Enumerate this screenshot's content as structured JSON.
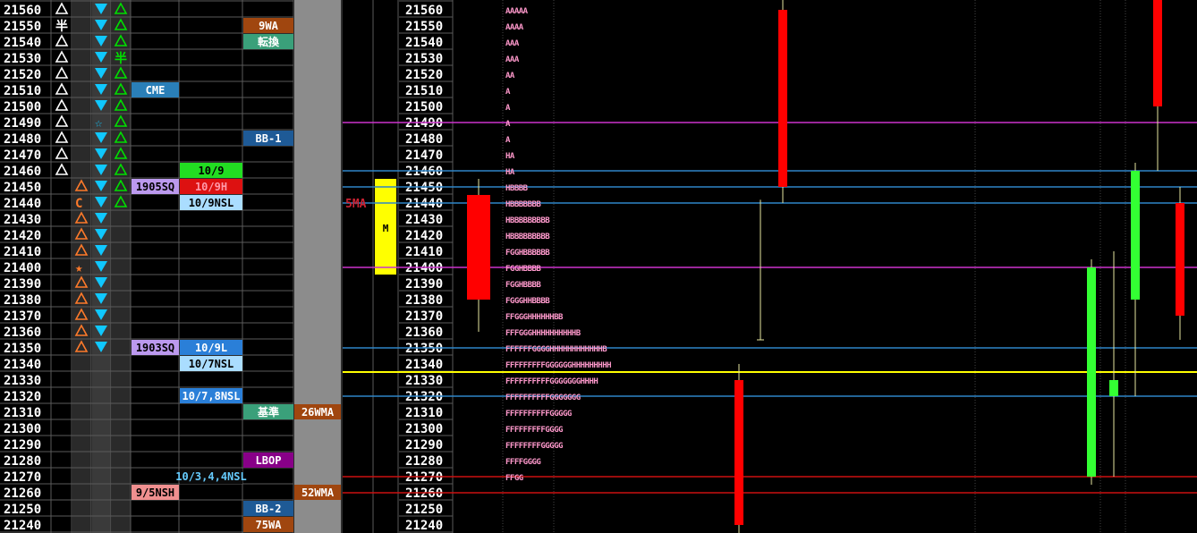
{
  "colors": {
    "grid": "#5a5a5a",
    "price_text": "#ffffff",
    "up_triangle": "#ffffff",
    "green_triangle": "#00e000",
    "cyan_triangle": "#10c8ff",
    "orange_triangle": "#ff7a2a",
    "candle_red": "#ff0000",
    "candle_green": "#33ff33",
    "tpo_text": "#ff99cc",
    "line_magenta": "#cc33cc",
    "line_blue": "#2f86c8",
    "line_yellow": "#ffff00",
    "line_red": "#cc1111",
    "gray_column": "#8c8c8c"
  },
  "prices": [
    21560,
    21550,
    21540,
    21530,
    21520,
    21510,
    21500,
    21490,
    21480,
    21470,
    21460,
    21450,
    21440,
    21430,
    21420,
    21410,
    21400,
    21390,
    21380,
    21370,
    21360,
    21350,
    21340,
    21330,
    21320,
    21310,
    21300,
    21290,
    21280,
    21270,
    21260,
    21250,
    21240
  ],
  "markers": {
    "col1": {
      "rows": [
        0,
        1,
        2,
        3,
        4,
        5,
        6,
        7,
        8,
        9,
        10
      ],
      "symbols": {
        "1": "半"
      }
    },
    "col2": {
      "rows": [
        11,
        12,
        13,
        14,
        15,
        16,
        17,
        18,
        19,
        20,
        21
      ],
      "symbols": {
        "12": "C",
        "16": "★"
      }
    },
    "col3": {
      "rows": [
        0,
        1,
        2,
        3,
        4,
        5,
        6,
        7,
        8,
        9,
        10,
        11,
        12,
        13,
        14,
        15,
        16,
        17,
        18,
        19,
        20,
        21
      ],
      "symbols": {
        "7": "☆"
      }
    },
    "col4": {
      "rows": [
        0,
        1,
        2,
        3,
        4,
        5,
        6,
        7,
        8,
        9,
        10,
        11,
        12
      ],
      "symbols": {
        "3": "半"
      }
    }
  },
  "labels": [
    {
      "row": 5,
      "col": "a",
      "text": "CME",
      "bg": "#2a7fb8",
      "fg": "#ffffff"
    },
    {
      "row": 10,
      "col": "b",
      "text": "10/9",
      "bg": "#22dd22",
      "fg": "#000000"
    },
    {
      "row": 11,
      "col": "a",
      "text": "1905SQ",
      "bg": "#bb99ee",
      "fg": "#000000"
    },
    {
      "row": 11,
      "col": "b",
      "text": "10/9H",
      "bg": "#dd1111",
      "fg": "#ff99aa"
    },
    {
      "row": 12,
      "col": "b",
      "text": "10/9NSL",
      "bg": "#aaddff",
      "fg": "#000000"
    },
    {
      "row": 21,
      "col": "a",
      "text": "1903SQ",
      "bg": "#bb99ee",
      "fg": "#000000"
    },
    {
      "row": 21,
      "col": "b",
      "text": "10/9L",
      "bg": "#2a7fd8",
      "fg": "#ffffff"
    },
    {
      "row": 22,
      "col": "b",
      "text": "10/7NSL",
      "bg": "#aaddff",
      "fg": "#000000"
    },
    {
      "row": 24,
      "col": "b",
      "text": "10/7,8NSL",
      "bg": "#2a7fd8",
      "fg": "#ffffff"
    },
    {
      "row": 29,
      "col": "b",
      "text": "10/3,4,4NSL",
      "bg": "#0a0a0a",
      "fg": "#66ccff"
    },
    {
      "row": 30,
      "col": "a",
      "text": "9/5NSH",
      "bg": "#f09090",
      "fg": "#000000"
    },
    {
      "row": 1,
      "col": "c",
      "text": "9WA",
      "bg": "#a0460f",
      "fg": "#ffffff"
    },
    {
      "row": 2,
      "col": "c",
      "text": "転換",
      "bg": "#3aa07a",
      "fg": "#ffffff"
    },
    {
      "row": 8,
      "col": "c",
      "text": "BB-1",
      "bg": "#1e5a96",
      "fg": "#ffffff"
    },
    {
      "row": 25,
      "col": "c",
      "text": "基準",
      "bg": "#3aa07a",
      "fg": "#ffffff"
    },
    {
      "row": 28,
      "col": "c",
      "text": "LBOP",
      "bg": "#880088",
      "fg": "#ffffff"
    },
    {
      "row": 31,
      "col": "c",
      "text": "BB-2",
      "bg": "#1e5a96",
      "fg": "#ffffff"
    },
    {
      "row": 32,
      "col": "c",
      "text": "75WA",
      "bg": "#a0460f",
      "fg": "#ffffff"
    },
    {
      "row": 25,
      "col": "d",
      "text": "26WMA",
      "bg": "#a0460f",
      "fg": "#ffffff"
    },
    {
      "row": 30,
      "col": "d",
      "text": "52WMA",
      "bg": "#a0460f",
      "fg": "#ffffff"
    }
  ],
  "m_block": {
    "text": "M",
    "rows_from": 11,
    "rows_to": 16,
    "color": "#ffff00"
  },
  "sma_label": {
    "text": "5MA",
    "color": "#cc2233"
  },
  "tpo": {
    "0": "AAAAA",
    "1": "AAAA",
    "2": "AAA",
    "3": "AAA",
    "4": "AA",
    "5": "A",
    "6": "A",
    "7": "A",
    "8": "A",
    "9": "HA",
    "10": "HA",
    "11": "HBBBB",
    "12": "HBBBBBBB",
    "13": "HBBBBBBBBB",
    "14": "HBBBBBBBBB",
    "15": "FGGHBBBBBB",
    "16": "FGGHBBBB",
    "17": "FGGHBBBB",
    "18": "FGGGHHBBBB",
    "19": "FFGGGHHHHHHBB",
    "20": "FFFGGGHHHHHHHHHHB",
    "21": "FFFFFFGGGGHHHHHHHHHHHHB",
    "22": "FFFFFFFFFGGGGGGHHHHHHHHH",
    "23": "FFFFFFFFFFGGGGGGGHHHH",
    "24": "FFFFFFFFFFGGGGGGG",
    "25": "FFFFFFFFFFGGGGG",
    "26": "FFFFFFFFFGGGG",
    "27": "FFFFFFFFGGGGG",
    "28": "FFFFGGGG",
    "29": "FFGG"
  },
  "hlines": [
    {
      "price": 21490,
      "color": "#cc33cc"
    },
    {
      "price": 21460,
      "color": "#2f86c8"
    },
    {
      "price": 21450,
      "color": "#2f86c8"
    },
    {
      "price": 21440,
      "color": "#2f86c8"
    },
    {
      "price": 21400,
      "color": "#cc33cc"
    },
    {
      "price": 21350,
      "color": "#2f86c8"
    },
    {
      "price": 21335,
      "color": "#ffff00"
    },
    {
      "price": 21320,
      "color": "#2f86c8"
    },
    {
      "price": 21270,
      "color": "#cc1111"
    },
    {
      "price": 21260,
      "color": "#cc1111"
    }
  ],
  "candles": [
    {
      "slot": 0,
      "open": 21380,
      "close": 21445,
      "high": 21455,
      "low": 21360,
      "color": "red"
    },
    {
      "slot": 1,
      "open": 21240,
      "close": 21330,
      "high": 21340,
      "low": 21235,
      "color": "red"
    },
    {
      "slot": 2,
      "open": 21450,
      "close": 21560,
      "high": 21570,
      "low": 21440,
      "color": "red"
    },
    {
      "slot": 3,
      "open": 21360,
      "close": 21442,
      "high": 21442,
      "low": 21355,
      "color": "thin"
    },
    {
      "slot": 4,
      "open": 21270,
      "close": 21400,
      "high": 21405,
      "low": 21265,
      "color": "green"
    },
    {
      "slot": 5,
      "open": 21320,
      "close": 21330,
      "high": 21410,
      "low": 21270,
      "color": "green"
    },
    {
      "slot": 6,
      "open": 21380,
      "close": 21460,
      "high": 21465,
      "low": 21320,
      "color": "green"
    },
    {
      "slot": 7,
      "open": 21500,
      "close": 21570,
      "high": 21575,
      "low": 21460,
      "color": "red"
    },
    {
      "slot": 8,
      "open": 21370,
      "close": 21440,
      "high": 21450,
      "low": 21355,
      "color": "red"
    }
  ]
}
